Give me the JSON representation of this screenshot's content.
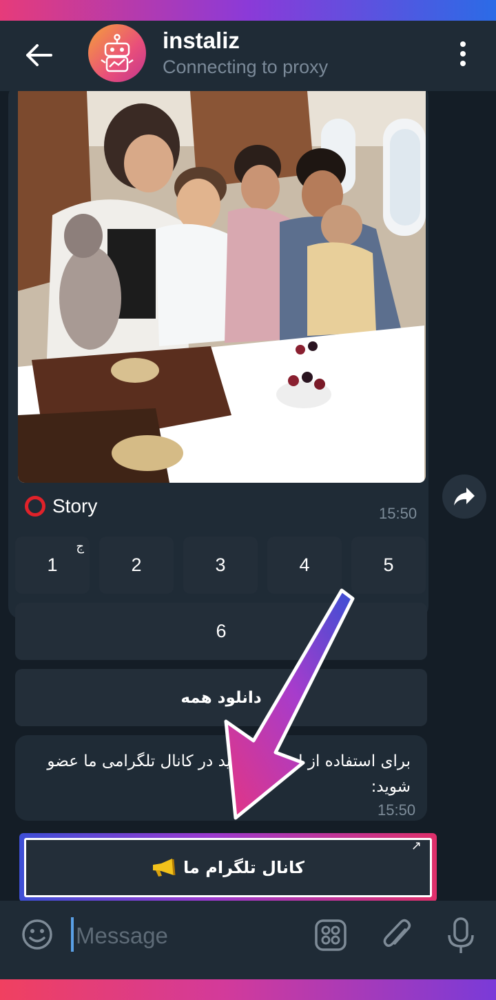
{
  "header": {
    "title": "instaliz",
    "subtitle": "Connecting to proxy"
  },
  "message1": {
    "caption_prefix_icon": "red-circle-icon",
    "caption_text": "Story",
    "time": "15:50"
  },
  "keyboard": {
    "row1": [
      "1",
      "2",
      "3",
      "4",
      "5"
    ],
    "row1_mark": "ج",
    "row2": [
      "6"
    ],
    "download_all": "دانلود همه"
  },
  "message2": {
    "text": "برای استفاده از این ربات باید در کانال تلگرامی ما عضو شوید:",
    "time": "15:50"
  },
  "join_button": {
    "label": "کانال تلگرام ما",
    "icon": "megaphone-icon",
    "corner_mark": "↗"
  },
  "composer": {
    "placeholder": "Message"
  },
  "colors": {
    "header_bg": "#1f2b36",
    "chat_bg": "#141d26",
    "button_bg": "#232e39",
    "accent_gradient": [
      "#3e4fd6",
      "#9a3ad0",
      "#e0306a"
    ]
  }
}
